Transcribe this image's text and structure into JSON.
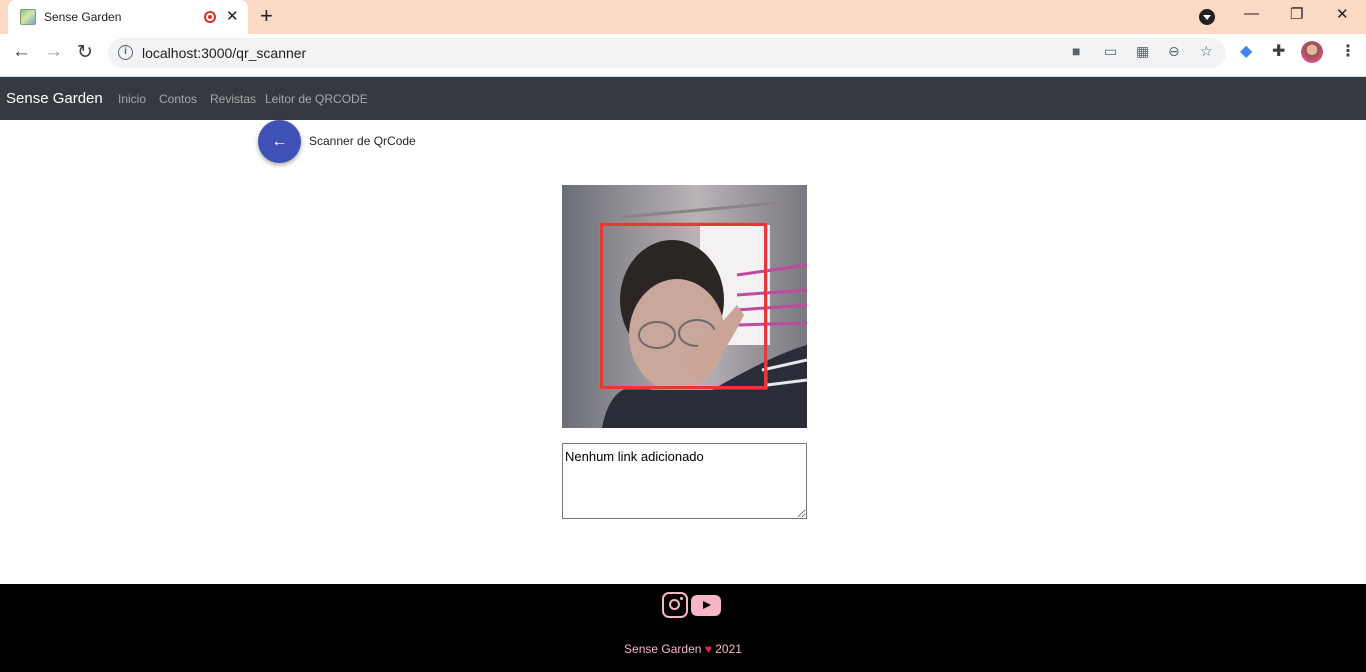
{
  "browser": {
    "tab_title": "Sense Garden",
    "tab_close": "✕",
    "new_tab": "+",
    "url": "localhost:3000/qr_scanner",
    "window_controls": {
      "minimize": "—",
      "restore": "❐",
      "close": "✕"
    },
    "nav_icons": {
      "back": "←",
      "forward": "→",
      "reload": "↻"
    },
    "omnibox_icons": [
      "camera-icon",
      "cast-icon",
      "qr-icon",
      "zoom-icon",
      "bookmark-star-icon"
    ],
    "extension_icons": [
      "graduation-cap-icon",
      "puzzle-icon",
      "profile-avatar",
      "menu-icon"
    ]
  },
  "navbar": {
    "brand": "Sense Garden",
    "links": [
      "Inicio",
      "Contos",
      "Revistas",
      "Leitor de QRCODE"
    ]
  },
  "page": {
    "back_icon": "←",
    "title": "Scanner de QrCode",
    "result_text": "Nenhum link adicionado"
  },
  "footer": {
    "social_icons": [
      "instagram-icon",
      "youtube-icon"
    ],
    "credit_prefix": "Sense Garden",
    "heart": "♥",
    "credit_year": "2021"
  },
  "colors": {
    "tabstrip": "#fbd9c4",
    "navbar": "#343a40",
    "back_button": "#3f51b5",
    "scan_box": "#e53935",
    "footer": "#000000",
    "footer_text": "#f7b6c8"
  }
}
